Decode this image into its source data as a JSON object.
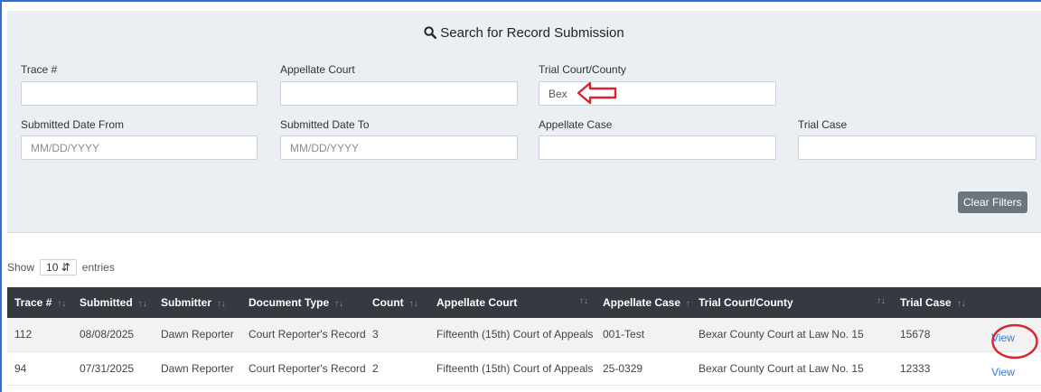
{
  "search": {
    "title": "Search for Record Submission",
    "fields": {
      "trace_label": "Trace #",
      "trace_value": "",
      "appellate_court_label": "Appellate Court",
      "appellate_court_value": "",
      "trial_court_label": "Trial Court/County",
      "trial_court_value": "Bex",
      "date_from_label": "Submitted Date From",
      "date_from_placeholder": "MM/DD/YYYY",
      "date_to_label": "Submitted Date To",
      "date_to_placeholder": "MM/DD/YYYY",
      "appellate_case_label": "Appellate Case",
      "appellate_case_value": "",
      "trial_case_label": "Trial Case",
      "trial_case_value": ""
    },
    "clear_filters": "Clear Filters"
  },
  "entries": {
    "show": "Show",
    "value": "10",
    "suffix": "entries"
  },
  "table": {
    "headers": [
      "Trace #",
      "Submitted",
      "Submitter",
      "Document Type",
      "Count",
      "Appellate Court",
      "Appellate Case",
      "Trial Court/County",
      "Trial Case"
    ],
    "rows": [
      {
        "trace": "112",
        "submitted": "08/08/2025",
        "submitter": "Dawn Reporter",
        "doc_type": "Court Reporter's Record",
        "count": "3",
        "appellate_court": "Fifteenth (15th) Court of Appeals",
        "appellate_case": "001-Test",
        "trial_court": "Bexar County Court at Law No. 15",
        "trial_case": "15678",
        "action": "View"
      },
      {
        "trace": "94",
        "submitted": "07/31/2025",
        "submitter": "Dawn Reporter",
        "doc_type": "Court Reporter's Record",
        "count": "2",
        "appellate_court": "Fifteenth (15th) Court of Appeals",
        "appellate_case": "25-0329",
        "trial_court": "Bexar County Court at Law No. 15",
        "trial_case": "12333",
        "action": "View"
      }
    ]
  },
  "annotations": {
    "arrow_color": "#d9232e",
    "circle_color": "#d9232e"
  }
}
